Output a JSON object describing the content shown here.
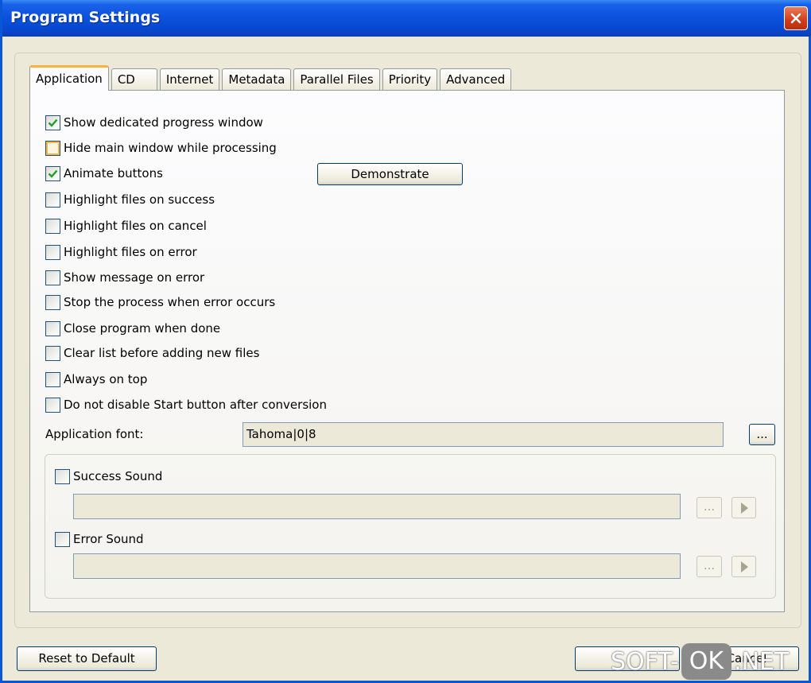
{
  "window": {
    "title": "Program Settings"
  },
  "tabs": [
    {
      "label": "Application",
      "active": true
    },
    {
      "label": "CD"
    },
    {
      "label": "Internet"
    },
    {
      "label": "Metadata"
    },
    {
      "label": "Parallel Files"
    },
    {
      "label": "Priority"
    },
    {
      "label": "Advanced"
    }
  ],
  "options": [
    {
      "label": "Show dedicated progress window",
      "checked": true
    },
    {
      "label": "Hide main window while processing",
      "checked": false
    },
    {
      "label": "Animate buttons",
      "checked": true
    },
    {
      "label": "Highlight files on success",
      "checked": false
    },
    {
      "label": "Highlight files on cancel",
      "checked": false
    },
    {
      "label": "Highlight files on error",
      "checked": false
    },
    {
      "label": "Show message on error",
      "checked": false
    },
    {
      "label": "Stop the process when error occurs",
      "checked": false
    },
    {
      "label": "Close program when done",
      "checked": false
    },
    {
      "label": "Clear list before adding new files",
      "checked": false
    },
    {
      "label": "Always on top",
      "checked": false
    },
    {
      "label": "Do not disable Start button after conversion",
      "checked": false
    }
  ],
  "demonstrate_label": "Demonstrate",
  "font": {
    "label": "Application font:",
    "value": "Tahoma|0|8",
    "browse_label": "..."
  },
  "sounds": {
    "success": {
      "label": "Success Sound",
      "checked": false,
      "path": "",
      "browse_label": "..."
    },
    "error": {
      "label": "Error Sound",
      "checked": false,
      "path": "",
      "browse_label": "..."
    }
  },
  "footer": {
    "reset_label": "Reset to Default",
    "cancel_label": "Cancel"
  },
  "watermark": {
    "part1": "SOFT-",
    "part2": "OK",
    "part3": ".NET"
  },
  "colors": {
    "title_bar": "#0b52dd",
    "check_mark": "#21a121",
    "hover_orange": "#f8b548"
  }
}
